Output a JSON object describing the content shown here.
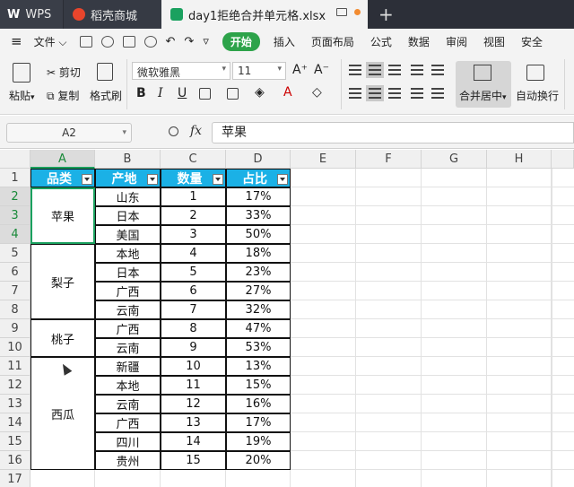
{
  "tabs": [
    {
      "label": "WPS"
    },
    {
      "label": "稻壳商城"
    },
    {
      "label": "day1拒绝合并单元格.xlsx"
    }
  ],
  "menu": {
    "file": "文件",
    "items": [
      "开始",
      "插入",
      "页面布局",
      "公式",
      "数据",
      "审阅",
      "视图",
      "安全"
    ]
  },
  "ribbon": {
    "paste": "粘贴",
    "cut": "剪切",
    "copy": "复制",
    "format_painter": "格式刷",
    "font_name": "微软雅黑",
    "font_size": "11",
    "merge_center": "合并居中",
    "wrap_text": "自动换行"
  },
  "formula_bar": {
    "name_box": "A2",
    "fx": "fx",
    "content": "苹果"
  },
  "sheet": {
    "columns": [
      "A",
      "B",
      "C",
      "D",
      "E",
      "F",
      "G",
      "H"
    ],
    "rows": [
      "1",
      "2",
      "3",
      "4",
      "5",
      "6",
      "7",
      "8",
      "9",
      "10",
      "11",
      "12",
      "13",
      "14",
      "15",
      "16",
      "17"
    ],
    "selected_column": "A",
    "selected_rows": [
      "2",
      "3",
      "4"
    ],
    "headers": [
      "品类",
      "产地",
      "数量",
      "占比"
    ],
    "merged_categories": [
      {
        "label": "苹果"
      },
      {
        "label": "梨子"
      },
      {
        "label": "桃子"
      },
      {
        "label": "西瓜"
      }
    ],
    "data": [
      {
        "origin": "山东",
        "qty": "1",
        "pct": "17%"
      },
      {
        "origin": "日本",
        "qty": "2",
        "pct": "33%"
      },
      {
        "origin": "美国",
        "qty": "3",
        "pct": "50%"
      },
      {
        "origin": "本地",
        "qty": "4",
        "pct": "18%"
      },
      {
        "origin": "日本",
        "qty": "5",
        "pct": "23%"
      },
      {
        "origin": "广西",
        "qty": "6",
        "pct": "27%"
      },
      {
        "origin": "云南",
        "qty": "7",
        "pct": "32%"
      },
      {
        "origin": "广西",
        "qty": "8",
        "pct": "47%"
      },
      {
        "origin": "云南",
        "qty": "9",
        "pct": "53%"
      },
      {
        "origin": "新疆",
        "qty": "10",
        "pct": "13%"
      },
      {
        "origin": "本地",
        "qty": "11",
        "pct": "15%"
      },
      {
        "origin": "云南",
        "qty": "12",
        "pct": "16%"
      },
      {
        "origin": "广西",
        "qty": "13",
        "pct": "17%"
      },
      {
        "origin": "四川",
        "qty": "14",
        "pct": "19%"
      },
      {
        "origin": "贵州",
        "qty": "15",
        "pct": "20%"
      }
    ]
  }
}
